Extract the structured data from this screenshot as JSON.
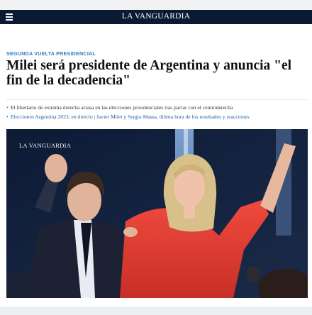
{
  "header": {
    "logo_text": "LA VANGUARDIA",
    "menu_icon": "hamburger-menu-icon",
    "background_color": "#0b1a33"
  },
  "article": {
    "kicker": "SEGUNDA VUELTA PRESIDENCIAL",
    "headline": "Milei será presidente de Argentina y anuncia \"el fin de la decadencia\"",
    "bullets": [
      {
        "text": "El libertario de extrema derecha arrasa en las elecciones presidenciales tras pactar con el centroderecha"
      },
      {
        "text": "Elecciones Argentina 2023, en directo | Javier Milei y Sergio Massa, última hora de los resultados y reacciones"
      }
    ],
    "photo": {
      "watermark": "LA VANGUARDIA"
    }
  },
  "colors": {
    "kicker": "#2f7fc1",
    "link": "#1b5fa0",
    "headline": "#111111"
  }
}
